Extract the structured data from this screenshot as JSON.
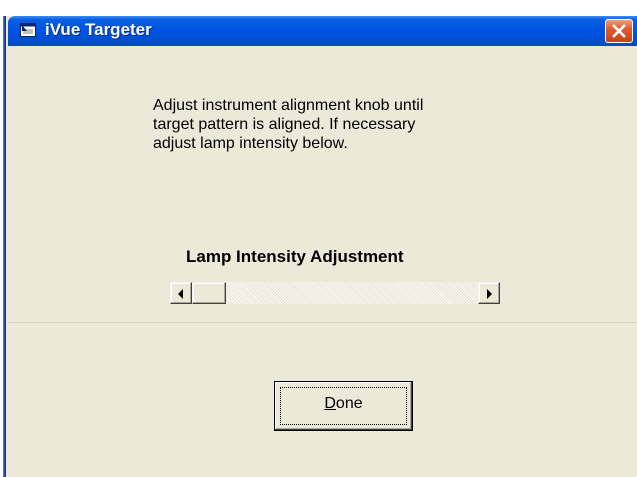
{
  "window": {
    "title": "iVue Targeter",
    "close_icon": "close-icon",
    "app_icon": "app-window-icon",
    "titlebar_color": "#0054e3",
    "close_color": "#e05b32",
    "background_color": "#ece9d8"
  },
  "instructions": {
    "line1": "Adjust instrument alignment knob until",
    "line2": "target pattern is aligned.  If necessary",
    "line3": "adjust lamp intensity below."
  },
  "lamp_slider": {
    "label": "Lamp Intensity Adjustment",
    "value_fraction": 0.0,
    "left_arrow_icon": "left-arrow-icon",
    "right_arrow_icon": "right-arrow-icon"
  },
  "done_button": {
    "mnemonic": "D",
    "label_rest": "one"
  }
}
